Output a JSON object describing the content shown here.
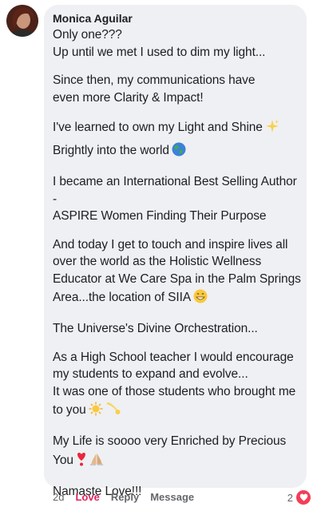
{
  "comment": {
    "author": "Monica Aguilar",
    "lines": [
      "Only one???",
      "Up until we met I used to dim my light...",
      "",
      "Since then, my communications have",
      "even more Clarity & Impact!",
      "",
      "I've learned to own my Light and Shine",
      "Brightly into the world",
      "",
      "I became an International Best Selling Author",
      "-",
      "ASPIRE Women Finding Their Purpose",
      "",
      "And today I get to touch and inspire lives all",
      "over the world as the Holistic Wellness",
      "Educator at We Care Spa in the Palm Springs",
      "Area...the location of SIIA",
      "",
      "The Universe's Divine Orchestration...",
      "",
      "As a High School teacher I would encourage",
      "my students to expand and evolve...",
      "It was one of those students who brought me",
      "to you",
      "",
      "My Life is soooo very Enriched by Precious",
      "You",
      "",
      "Namaste Love!!!"
    ],
    "emojis": [
      "sparkles",
      "globe",
      "grin",
      "sun",
      "comet",
      "heart-exclamation",
      "praying-hands"
    ]
  },
  "actions": {
    "time": "2d",
    "love": "Love",
    "reply": "Reply",
    "message": "Message"
  },
  "reactions": {
    "count": "2",
    "type": "love",
    "color": "#f33e58"
  }
}
